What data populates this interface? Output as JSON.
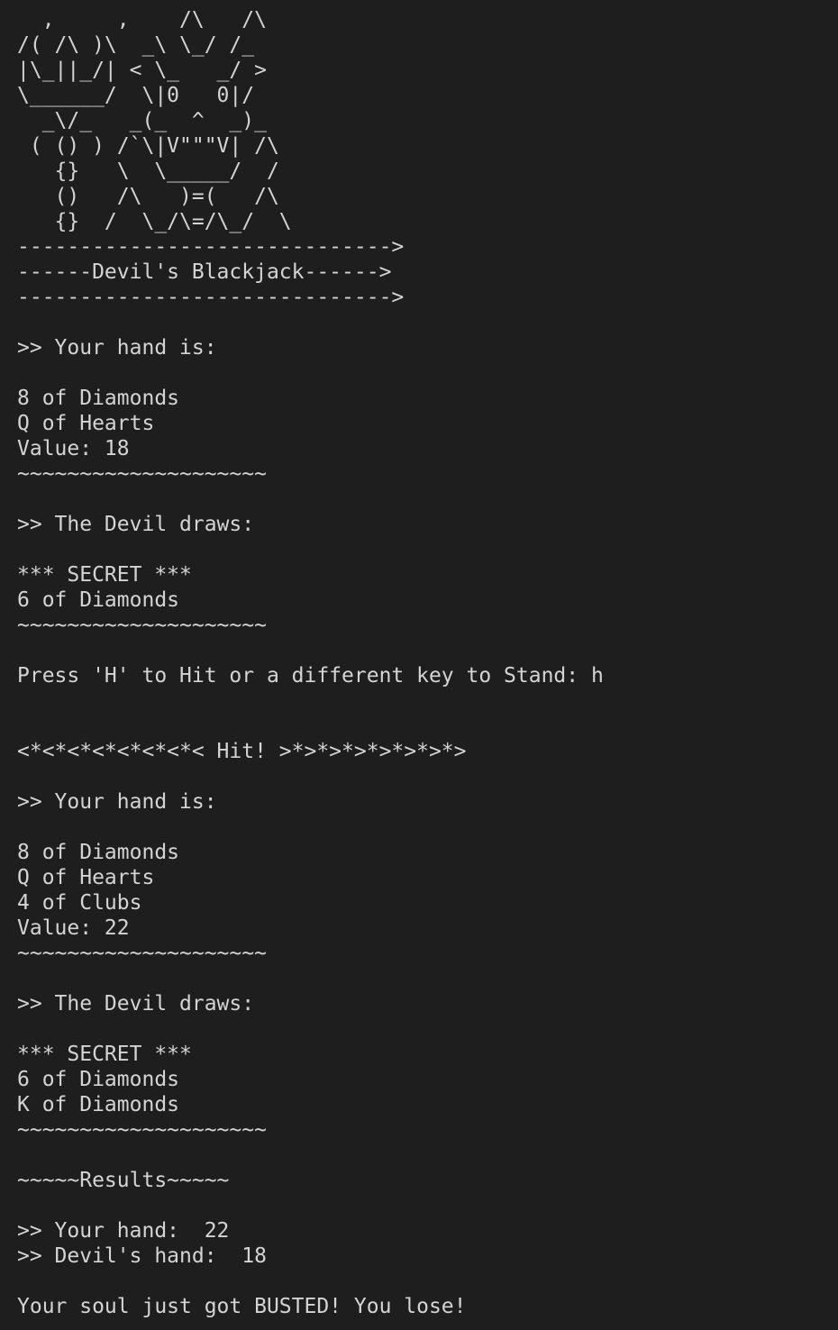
{
  "terminal": {
    "lines": [
      "  ,     ,    /\\   /\\",
      "/( /\\ )\\  _\\ \\_/ /_",
      "|\\_||_/| < \\_   _/ >",
      "\\______/  \\|0   0|/",
      "  _\\/_   _(_  ^  _)_",
      " ( () ) /`\\|V\"\"\"V| /\\",
      "   {}   \\  \\_____/  /",
      "   ()   /\\   )=(   /\\",
      "   {}  /  \\_/\\=/\\_/  \\",
      "------------------------------>",
      "------Devil's Blackjack------>",
      "------------------------------>",
      "",
      ">> Your hand is:",
      "",
      "8 of Diamonds",
      "Q of Hearts",
      "Value: 18",
      "~~~~~~~~~~~~~~~~~~~~",
      "",
      ">> The Devil draws:",
      "",
      "*** SECRET ***",
      "6 of Diamonds",
      "~~~~~~~~~~~~~~~~~~~~",
      "",
      "Press 'H' to Hit or a different key to Stand: h",
      "",
      "",
      "<*<*<*<*<*<*<*< Hit! >*>*>*>*>*>*>*>",
      "",
      ">> Your hand is:",
      "",
      "8 of Diamonds",
      "Q of Hearts",
      "4 of Clubs",
      "Value: 22",
      "~~~~~~~~~~~~~~~~~~~~",
      "",
      ">> The Devil draws:",
      "",
      "*** SECRET ***",
      "6 of Diamonds",
      "K of Diamonds",
      "~~~~~~~~~~~~~~~~~~~~",
      "",
      "~~~~~Results~~~~~",
      "",
      ">> Your hand:  22",
      ">> Devil's hand:  18",
      "",
      "Your soul just got BUSTED! You lose!"
    ]
  }
}
